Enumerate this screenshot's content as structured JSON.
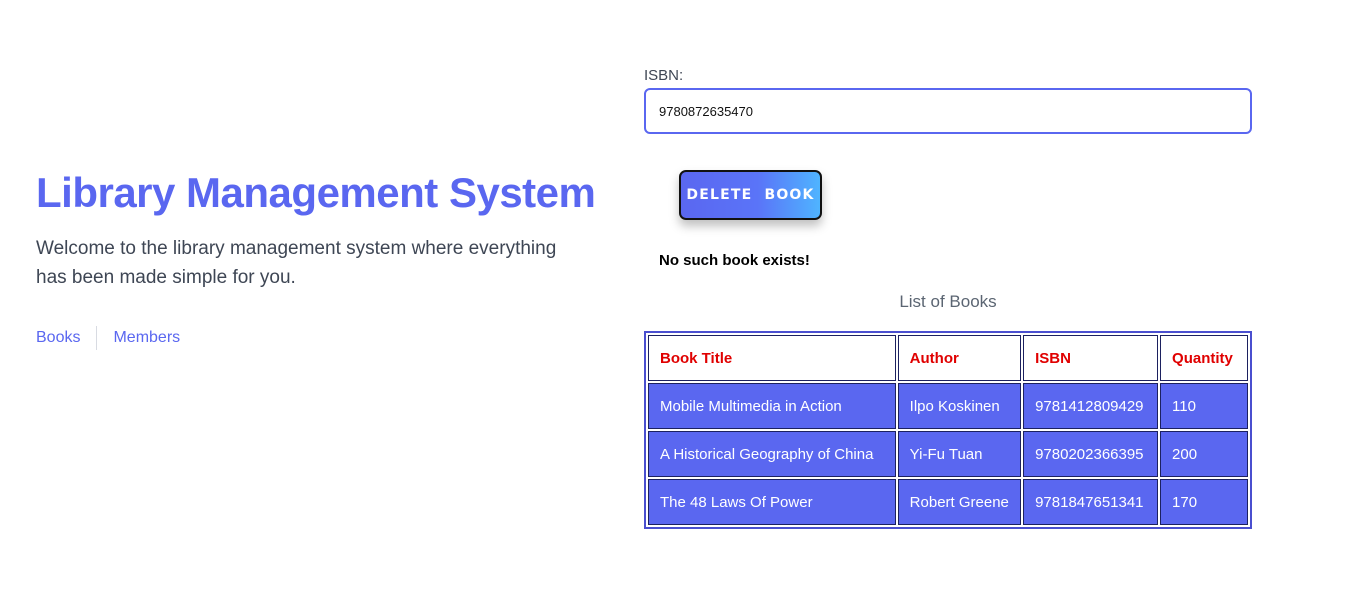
{
  "header": {
    "title": "Library Management System",
    "welcome": "Welcome to the library management system where everything has been made simple for you."
  },
  "nav": {
    "books": "Books",
    "members": "Members"
  },
  "form": {
    "isbn_label": "ISBN:",
    "isbn_value": "9780872635470",
    "delete_label": "DELETE BOOK",
    "message": "No such book exists!"
  },
  "books_table": {
    "caption": "List of Books",
    "columns": [
      "Book Title",
      "Author",
      "ISBN",
      "Quantity"
    ],
    "rows": [
      [
        "Mobile Multimedia in Action",
        "Ilpo Koskinen",
        "9781412809429",
        "110"
      ],
      [
        "A Historical Geography of China",
        "Yi-Fu Tuan",
        "9780202366395",
        "200"
      ],
      [
        "The 48 Laws Of Power",
        "Robert Greene",
        "9781847651341",
        "170"
      ]
    ]
  },
  "colors": {
    "accent": "#5a67f0",
    "header_text": "#e00000",
    "cell_text": "#ffffff"
  }
}
